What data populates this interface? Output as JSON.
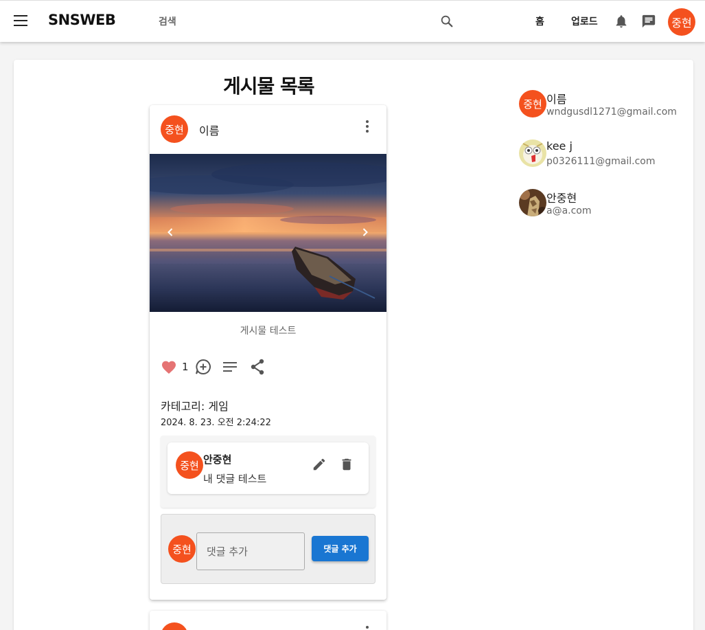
{
  "app": {
    "brand": "SNSWEB",
    "search_placeholder": "검색",
    "nav_home": "홈",
    "nav_upload": "업로드",
    "user_avatar_text": "중현"
  },
  "page": {
    "title": "게시물 목록"
  },
  "post": {
    "author_avatar_text": "중현",
    "author_name": "이름",
    "text": "게시물 테스트",
    "like_count": "1",
    "liked": true,
    "category_line": "카테고리: 게임",
    "date": "2024. 8. 23. 오전 2:24:22",
    "comments": [
      {
        "avatar_text": "중현",
        "author": "안중현",
        "body": "내 댓글 테스트"
      }
    ],
    "new_comment": {
      "avatar_text": "중현",
      "placeholder": "댓글 추가",
      "button_label": "댓글 추가"
    }
  },
  "next_post": {
    "author_avatar_text": "중현"
  },
  "users": [
    {
      "name": "이름",
      "email": "wndgusdl1271@gmail.com",
      "avatar_type": "initials",
      "avatar_text": "중현"
    },
    {
      "name": "kee j",
      "email": "p0326111@gmail.com",
      "avatar_type": "image"
    },
    {
      "name": "안중현",
      "email": "a@a.com",
      "avatar_type": "image"
    }
  ],
  "colors": {
    "avatar": "#f4511e",
    "primary_button": "#1976d2",
    "like": "#e57373"
  },
  "icons": [
    "menu-icon",
    "search-icon",
    "bell-icon",
    "chat-icon",
    "more-vert-icon",
    "chevron-left-icon",
    "chevron-right-icon",
    "heart-icon",
    "add-comment-icon",
    "notes-icon",
    "share-icon",
    "edit-icon",
    "delete-icon"
  ]
}
